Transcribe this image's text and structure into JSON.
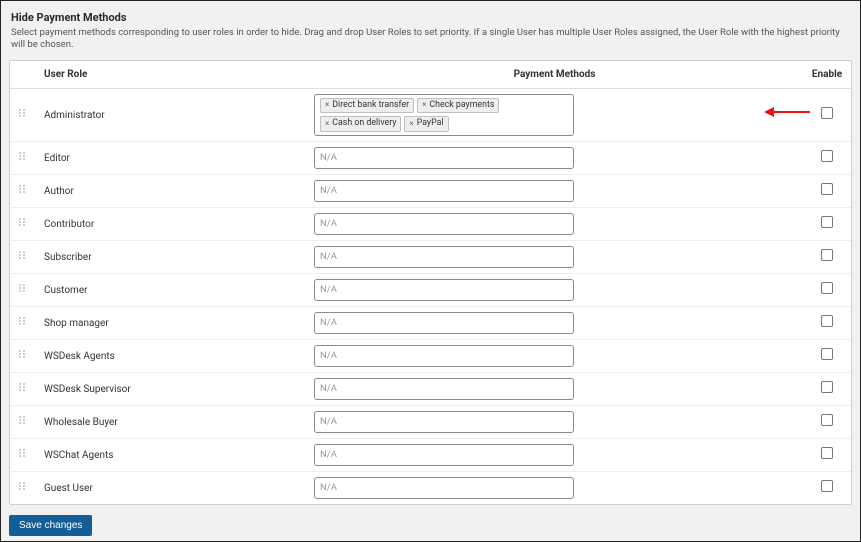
{
  "header": {
    "title": "Hide Payment Methods",
    "description": "Select payment methods corresponding to user roles in order to hide. Drag and drop User Roles to set priority. If a single User has multiple User Roles assigned, the User Role with the highest priority will be chosen."
  },
  "table": {
    "columns": {
      "role": "User Role",
      "payment": "Payment Methods",
      "enable": "Enable"
    },
    "placeholder": "N/A"
  },
  "roles": [
    {
      "name": "Administrator",
      "methods": [
        "Direct bank transfer",
        "Check payments",
        "Cash on delivery",
        "PayPal"
      ],
      "enabled": false,
      "annotated": true
    },
    {
      "name": "Editor",
      "methods": [],
      "enabled": false
    },
    {
      "name": "Author",
      "methods": [],
      "enabled": false
    },
    {
      "name": "Contributor",
      "methods": [],
      "enabled": false
    },
    {
      "name": "Subscriber",
      "methods": [],
      "enabled": false
    },
    {
      "name": "Customer",
      "methods": [],
      "enabled": false
    },
    {
      "name": "Shop manager",
      "methods": [],
      "enabled": false
    },
    {
      "name": "WSDesk Agents",
      "methods": [],
      "enabled": false
    },
    {
      "name": "WSDesk Supervisor",
      "methods": [],
      "enabled": false
    },
    {
      "name": "Wholesale Buyer",
      "methods": [],
      "enabled": false
    },
    {
      "name": "WSChat Agents",
      "methods": [],
      "enabled": false
    },
    {
      "name": "Guest User",
      "methods": [],
      "enabled": false
    }
  ],
  "actions": {
    "save": "Save changes"
  },
  "tag_remove_glyph": "×"
}
